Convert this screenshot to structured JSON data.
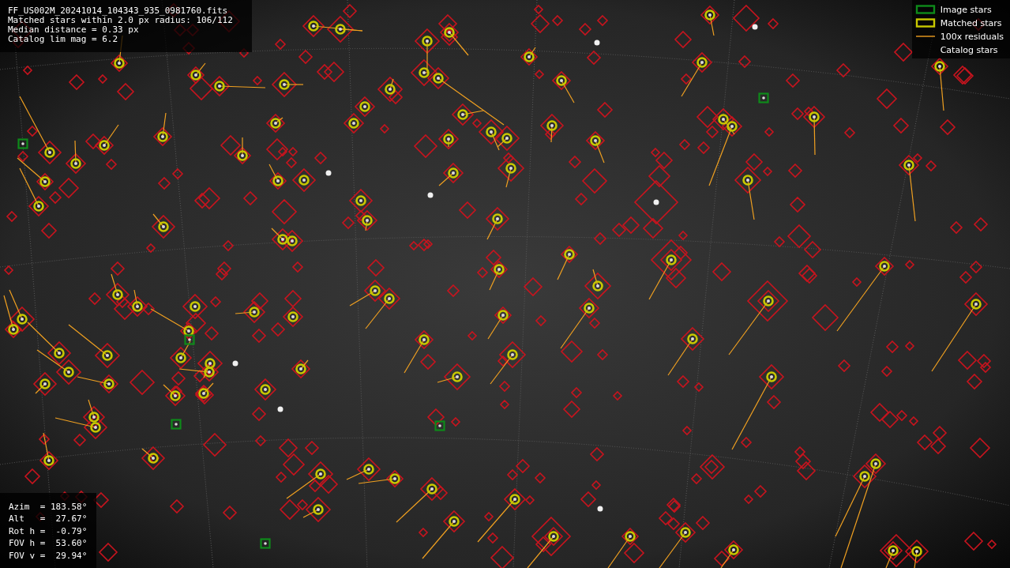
{
  "info": {
    "lines": [
      "FF_US002M_20241014_104343_935_0981760.fits",
      "Matched stars within 2.0 px radius: 106/112",
      "Median distance = 0.33 px",
      "Catalog lim mag = 6.2"
    ]
  },
  "legend": [
    {
      "kind": "image",
      "label": "Image stars"
    },
    {
      "kind": "matched",
      "label": "Matched stars"
    },
    {
      "kind": "residual",
      "label": "100x residuals"
    },
    {
      "kind": "catalog",
      "label": "Catalog stars"
    }
  ],
  "pointing": {
    "lines": [
      "Azim  = 183.58°",
      "Alt   =  27.67°",
      "Rot h =  -0.79°",
      "FOV h =  53.60°",
      "FOV v =  29.94°"
    ]
  }
}
